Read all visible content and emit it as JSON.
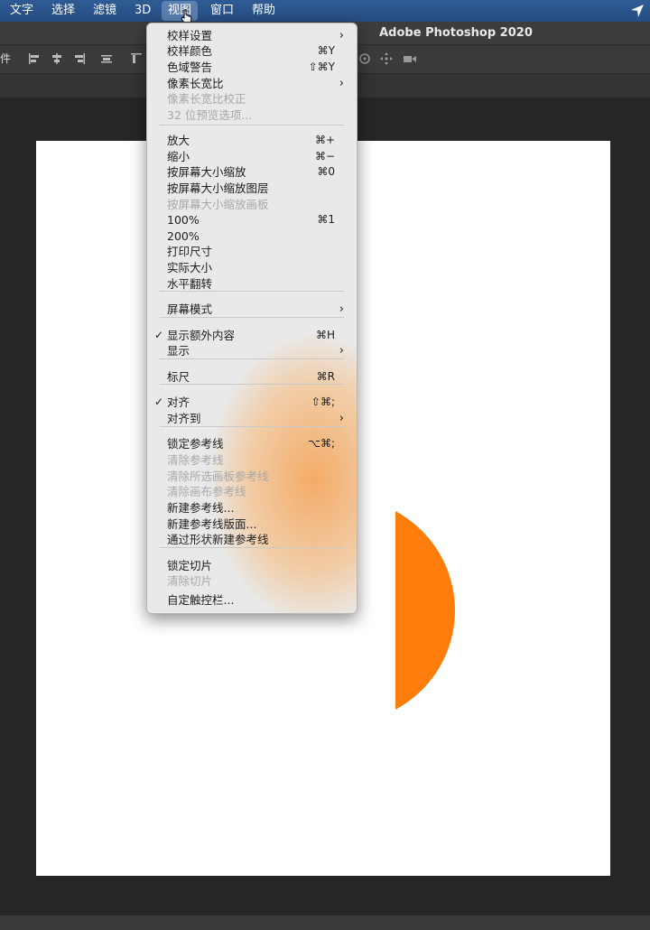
{
  "menubar": {
    "items": [
      "文字",
      "选择",
      "滤镜",
      "3D",
      "视图",
      "窗口",
      "帮助"
    ],
    "active": "视图"
  },
  "window": {
    "title": "Adobe Photoshop 2020"
  },
  "optbar": {
    "cut_text": "件"
  },
  "canvas": {
    "circle_color": "#ff7d0c",
    "background": "#ffffff"
  },
  "view_menu": {
    "items": [
      {
        "label": "校样设置",
        "shortcut": "",
        "submenu": true,
        "disabled": false,
        "checked": false
      },
      {
        "label": "校样颜色",
        "shortcut": "⌘Y",
        "submenu": false,
        "disabled": false,
        "checked": false
      },
      {
        "label": "色域警告",
        "shortcut": "⇧⌘Y",
        "submenu": false,
        "disabled": false,
        "checked": false
      },
      {
        "label": "像素长宽比",
        "shortcut": "",
        "submenu": true,
        "disabled": false,
        "checked": false
      },
      {
        "label": "像素长宽比校正",
        "shortcut": "",
        "submenu": false,
        "disabled": true,
        "checked": false
      },
      {
        "label": "32 位预览选项...",
        "shortcut": "",
        "submenu": false,
        "disabled": true,
        "checked": false
      },
      {
        "label": "放大",
        "shortcut": "⌘+",
        "submenu": false,
        "disabled": false,
        "checked": false
      },
      {
        "label": "缩小",
        "shortcut": "⌘−",
        "submenu": false,
        "disabled": false,
        "checked": false
      },
      {
        "label": "按屏幕大小缩放",
        "shortcut": "⌘0",
        "submenu": false,
        "disabled": false,
        "checked": false
      },
      {
        "label": "按屏幕大小缩放图层",
        "shortcut": "",
        "submenu": false,
        "disabled": false,
        "checked": false
      },
      {
        "label": "按屏幕大小缩放画板",
        "shortcut": "",
        "submenu": false,
        "disabled": true,
        "checked": false
      },
      {
        "label": "100%",
        "shortcut": "⌘1",
        "submenu": false,
        "disabled": false,
        "checked": false
      },
      {
        "label": "200%",
        "shortcut": "",
        "submenu": false,
        "disabled": false,
        "checked": false
      },
      {
        "label": "打印尺寸",
        "shortcut": "",
        "submenu": false,
        "disabled": false,
        "checked": false
      },
      {
        "label": "实际大小",
        "shortcut": "",
        "submenu": false,
        "disabled": false,
        "checked": false
      },
      {
        "label": "水平翻转",
        "shortcut": "",
        "submenu": false,
        "disabled": false,
        "checked": false
      },
      {
        "label": "屏幕模式",
        "shortcut": "",
        "submenu": true,
        "disabled": false,
        "checked": false
      },
      {
        "label": "显示额外内容",
        "shortcut": "⌘H",
        "submenu": false,
        "disabled": false,
        "checked": true
      },
      {
        "label": "显示",
        "shortcut": "",
        "submenu": true,
        "disabled": false,
        "checked": false
      },
      {
        "label": "标尺",
        "shortcut": "⌘R",
        "submenu": false,
        "disabled": false,
        "checked": false
      },
      {
        "label": "对齐",
        "shortcut": "⇧⌘;",
        "submenu": false,
        "disabled": false,
        "checked": true
      },
      {
        "label": "对齐到",
        "shortcut": "",
        "submenu": true,
        "disabled": false,
        "checked": false
      },
      {
        "label": "锁定参考线",
        "shortcut": "⌥⌘;",
        "submenu": false,
        "disabled": false,
        "checked": false
      },
      {
        "label": "清除参考线",
        "shortcut": "",
        "submenu": false,
        "disabled": true,
        "checked": false
      },
      {
        "label": "清除所选画板参考线",
        "shortcut": "",
        "submenu": false,
        "disabled": true,
        "checked": false
      },
      {
        "label": "清除画布参考线",
        "shortcut": "",
        "submenu": false,
        "disabled": true,
        "checked": false
      },
      {
        "label": "新建参考线...",
        "shortcut": "",
        "submenu": false,
        "disabled": false,
        "checked": false
      },
      {
        "label": "新建参考线版面...",
        "shortcut": "",
        "submenu": false,
        "disabled": false,
        "checked": false
      },
      {
        "label": "通过形状新建参考线",
        "shortcut": "",
        "submenu": false,
        "disabled": false,
        "checked": false
      },
      {
        "label": "锁定切片",
        "shortcut": "",
        "submenu": false,
        "disabled": false,
        "checked": false
      },
      {
        "label": "清除切片",
        "shortcut": "",
        "submenu": false,
        "disabled": true,
        "checked": false
      },
      {
        "label": "自定触控栏...",
        "shortcut": "",
        "submenu": false,
        "disabled": false,
        "checked": false
      }
    ]
  }
}
